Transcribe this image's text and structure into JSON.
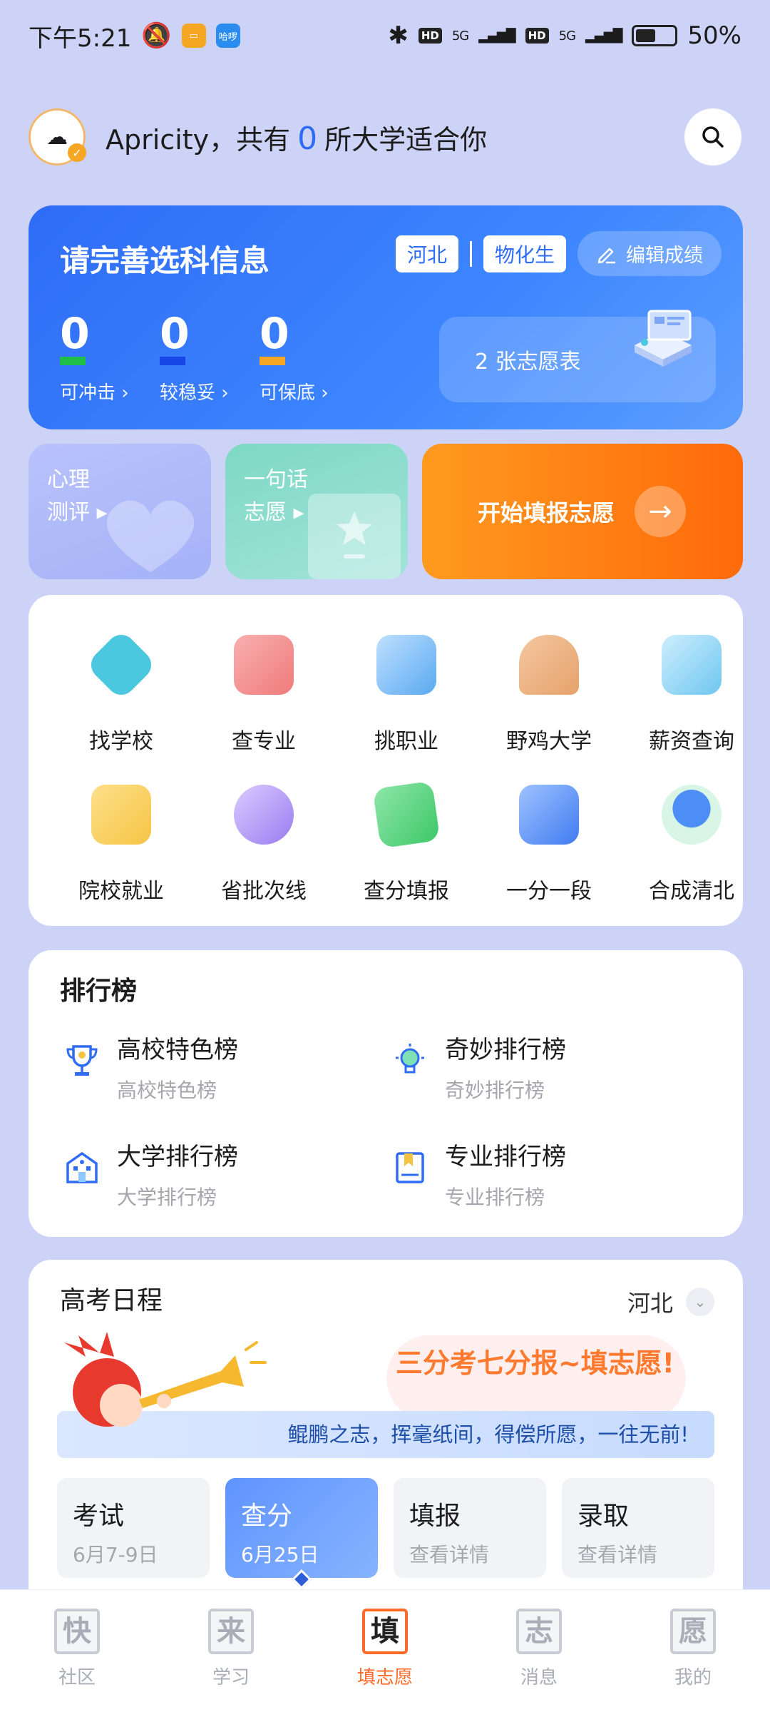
{
  "status_bar": {
    "time": "下午5:21",
    "app_badge_1": "",
    "app_badge_2": "哈啰",
    "hd1": "HD",
    "net1": "5G",
    "hd2": "HD",
    "net2": "5G",
    "battery": "50%",
    "battery_level": 0.5
  },
  "header": {
    "username": "Apricity，共有",
    "count": "0",
    "suffix": "所大学适合你"
  },
  "score_card": {
    "title": "请完善选科信息",
    "tag_province": "河北",
    "tag_subjects": "物化生",
    "edit_label": "编辑成绩",
    "stats": [
      {
        "num": "0",
        "label": "可冲击 ›",
        "color": "#1fbf46"
      },
      {
        "num": "0",
        "label": "较稳妥 ›",
        "color": "#1846e6"
      },
      {
        "num": "0",
        "label": "可保底 ›",
        "color": "#f5a623"
      }
    ],
    "tables_label": "2 张志愿表"
  },
  "quick": {
    "psy": "心理\n测评 ▸",
    "one": "一句话\n志愿 ▸",
    "start": "开始填报志愿"
  },
  "tools": [
    {
      "label": "找学校",
      "icon": "school-icon",
      "color": "#4cc7e0"
    },
    {
      "label": "查专业",
      "icon": "book-icon",
      "color": "#f07a7a"
    },
    {
      "label": "挑职业",
      "icon": "tie-icon",
      "color": "#5aa9f0"
    },
    {
      "label": "野鸡大学",
      "icon": "chicken-icon",
      "color": "#e6a26b"
    },
    {
      "label": "薪资查询",
      "icon": "salary-icon",
      "color": "#6ec6f0"
    },
    {
      "label": "院校就业",
      "icon": "check-folder-icon",
      "color": "#f6c445"
    },
    {
      "label": "省批次线",
      "icon": "chart-icon",
      "color": "#9b7bf0"
    },
    {
      "label": "查分填报",
      "icon": "edit-icon",
      "color": "#3dc868"
    },
    {
      "label": "一分一段",
      "icon": "segment-icon",
      "color": "#3f7cf0"
    },
    {
      "label": "合成清北",
      "icon": "merge-icon",
      "color": "#4c8ef6"
    }
  ],
  "ranking": {
    "title": "排行榜",
    "items": [
      {
        "main": "高校特色榜",
        "sub": "高校特色榜",
        "icon": "trophy-icon"
      },
      {
        "main": "奇妙排行榜",
        "sub": "奇妙排行榜",
        "icon": "lightbulb-icon"
      },
      {
        "main": "大学排行榜",
        "sub": "大学排行榜",
        "icon": "building-icon"
      },
      {
        "main": "专业排行榜",
        "sub": "专业排行榜",
        "icon": "bookmark-icon"
      }
    ]
  },
  "schedule": {
    "title": "高考日程",
    "province": "河北",
    "headline": "三分考七分报~填志愿!",
    "slogan": "鲲鹏之志，挥毫纸间，得偿所愿，一往无前!",
    "steps": [
      {
        "name": "考试",
        "date": "6月7-9日"
      },
      {
        "name": "查分",
        "date": "6月25日"
      },
      {
        "name": "填报",
        "date": "查看详情"
      },
      {
        "name": "录取",
        "date": "查看详情"
      }
    ]
  },
  "tabs": [
    {
      "glyph": "快",
      "label": "社区"
    },
    {
      "glyph": "来",
      "label": "学习"
    },
    {
      "glyph": "填",
      "label": "填志愿"
    },
    {
      "glyph": "志",
      "label": "消息"
    },
    {
      "glyph": "愿",
      "label": "我的"
    }
  ]
}
